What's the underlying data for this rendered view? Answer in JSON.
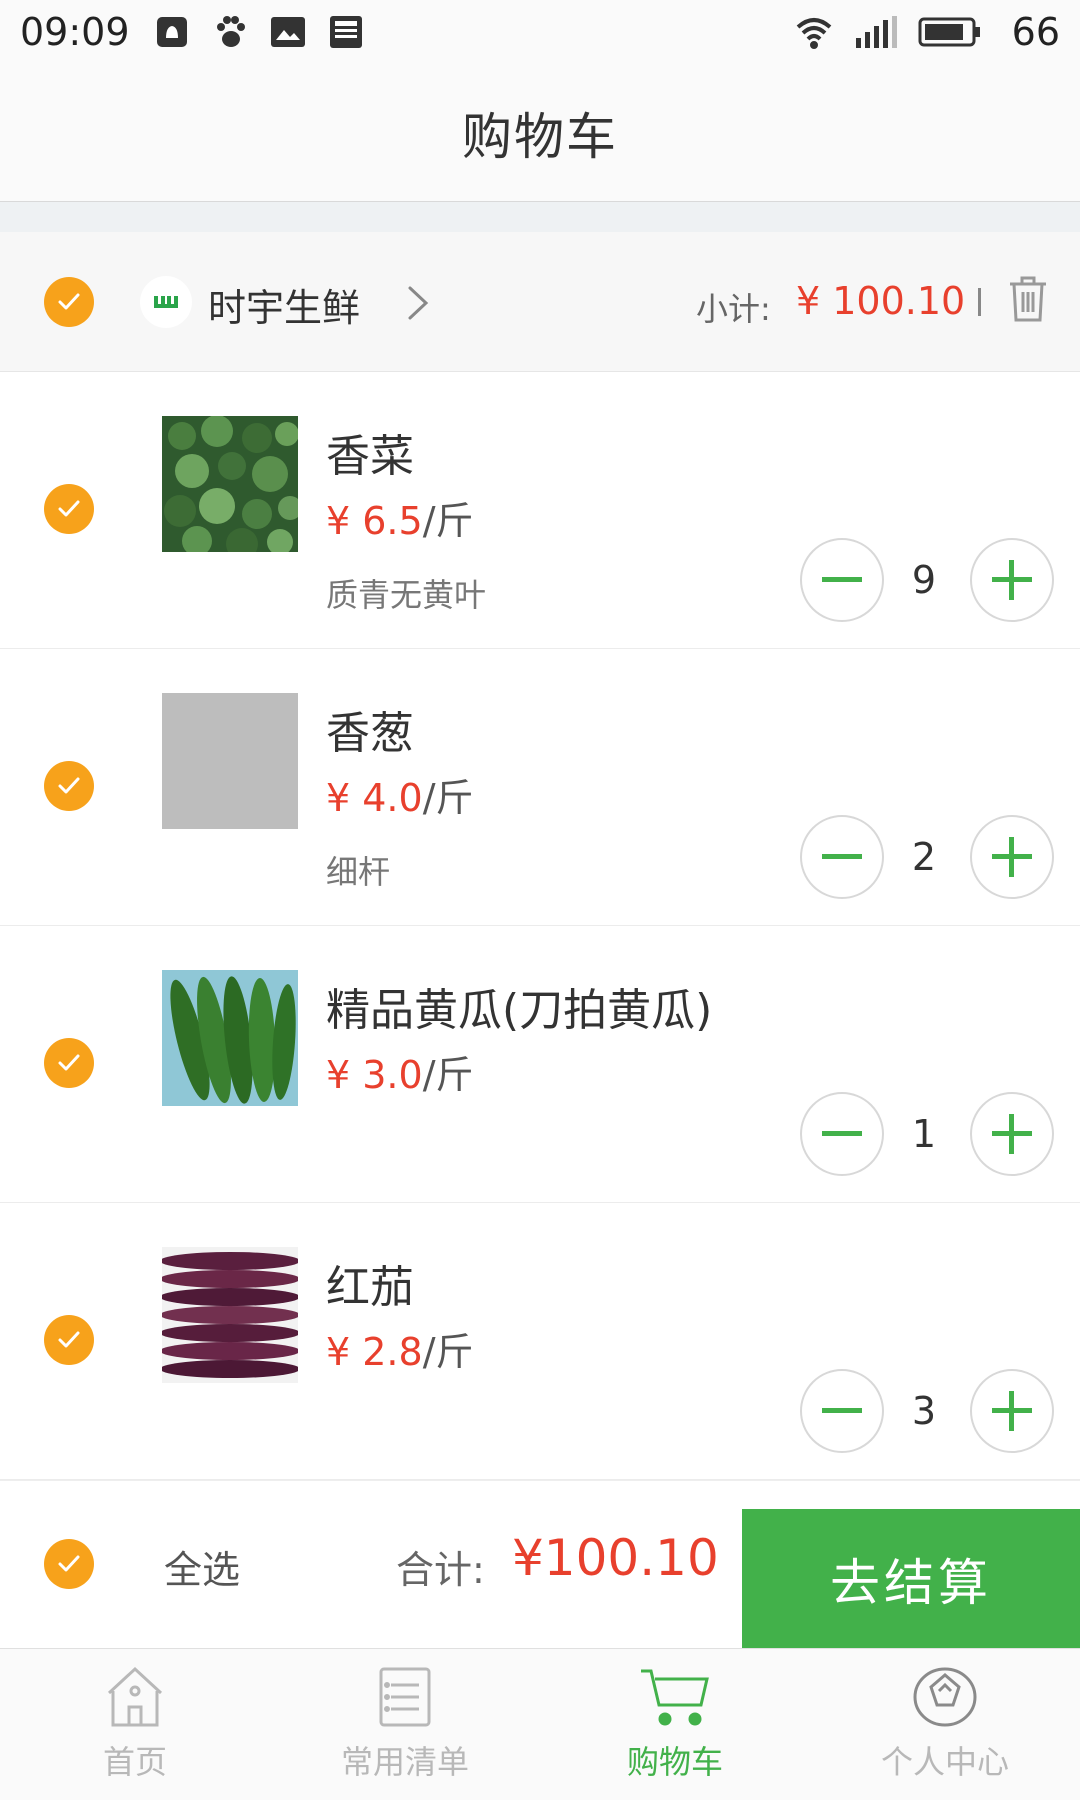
{
  "status_bar": {
    "time": "09:09",
    "left_icons": [
      "notification-icon",
      "baidu-paw-icon",
      "gallery-icon",
      "news-icon"
    ],
    "network": "4G",
    "battery": "66"
  },
  "header": {
    "title": "购物车"
  },
  "shop": {
    "name": "时宇生鲜",
    "subtotal_label": "小计:",
    "subtotal_value": "¥ 100.10",
    "checked": true
  },
  "items": [
    {
      "name": "香菜",
      "price": "¥ 6.5",
      "unit": "/斤",
      "desc": "质青无黄叶",
      "qty": "9",
      "image": "cilantro-photo",
      "checked": true
    },
    {
      "name": "香葱",
      "price": "¥ 4.0",
      "unit": "/斤",
      "desc": "细杆",
      "qty": "2",
      "image": "placeholder-gray",
      "checked": true
    },
    {
      "name": "精品黄瓜(刀拍黄瓜)",
      "price": "¥ 3.0",
      "unit": "/斤",
      "desc": "",
      "qty": "1",
      "image": "cucumber-photo",
      "checked": true
    },
    {
      "name": "红茄",
      "price": "¥ 2.8",
      "unit": "/斤",
      "desc": "",
      "qty": "3",
      "image": "eggplant-photo",
      "checked": true
    }
  ],
  "checkout": {
    "select_all_label": "全选",
    "total_label": "合计:",
    "total_value": "¥100.10",
    "button_label": "去结算"
  },
  "tabs": [
    {
      "label": "首页",
      "icon": "home-icon",
      "active": false
    },
    {
      "label": "常用清单",
      "icon": "list-icon",
      "active": false
    },
    {
      "label": "购物车",
      "icon": "cart-icon",
      "active": true
    },
    {
      "label": "个人中心",
      "icon": "profile-icon",
      "active": false
    }
  ],
  "colors": {
    "accent_green": "#42b14a",
    "price_red": "#e8402d",
    "check_orange": "#f7a21b"
  }
}
